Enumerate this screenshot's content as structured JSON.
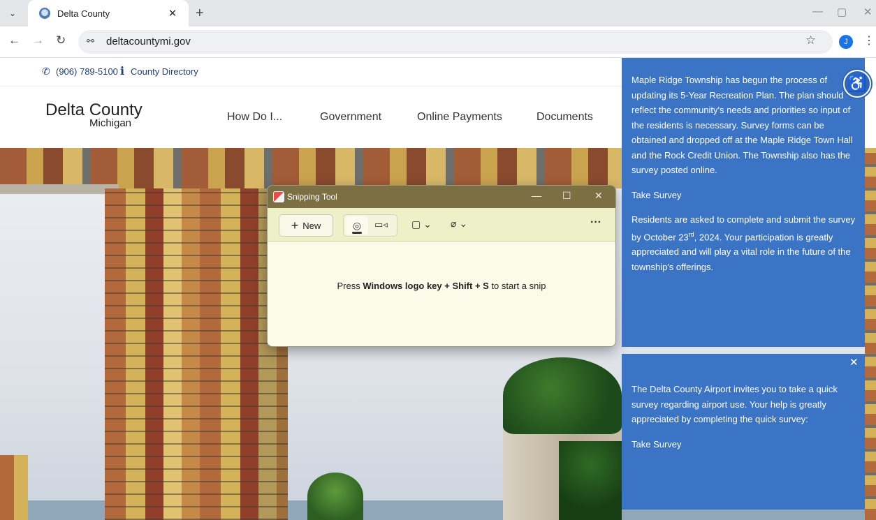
{
  "browser": {
    "tab_title": "Delta County",
    "tab_close": "✕",
    "new_tab": "+",
    "url": "deltacountymi.gov",
    "profile_initial": "J",
    "icons": [
      "tab-menu-icon",
      "favicon-icon",
      "close-icon",
      "plus-icon",
      "back-icon",
      "forward-icon",
      "reload-icon",
      "site-info-icon",
      "star-icon",
      "avatar",
      "kebab-icon",
      "minimize-icon",
      "restore-icon"
    ]
  },
  "site": {
    "phone": "(906) 789-5100",
    "directory": "County Directory",
    "logo_title": "Delta County",
    "logo_subtitle": "Michigan",
    "nav": [
      "How Do I...",
      "Government",
      "Online Payments",
      "Documents"
    ]
  },
  "snipping_tool": {
    "title": "Snipping Tool",
    "new_label": "New",
    "hint_prefix": "Press ",
    "hint_keys": "Windows logo key + Shift + S",
    "hint_suffix": " to start a snip",
    "accent": "#7c6f43"
  },
  "notice_1": {
    "paragraph_1": "Maple Ridge Township has begun the process of updating its 5-Year Recreation Plan. The plan should reflect the community's needs and priorities so input of the residents is necessary.  Survey forms can be obtained and dropped off at the Maple Ridge Town Hall and the Rock Credit Union. The Township also has the survey posted online.",
    "link": "Take Survey",
    "paragraph_2_a": "Residents are asked to complete and submit the survey by October 23",
    "paragraph_2_sup": "rd",
    "paragraph_2_b": ", 2024.  Your participation is greatly appreciated and will play a vital role in the future of the township's offerings.",
    "color": "#3b73c5"
  },
  "notice_2": {
    "paragraph_1": "The Delta County Airport invites you to take a quick survey regarding airport use.  Your help is greatly appreciated by completing the quick survey:",
    "link": "Take Survey",
    "close": "✕"
  }
}
